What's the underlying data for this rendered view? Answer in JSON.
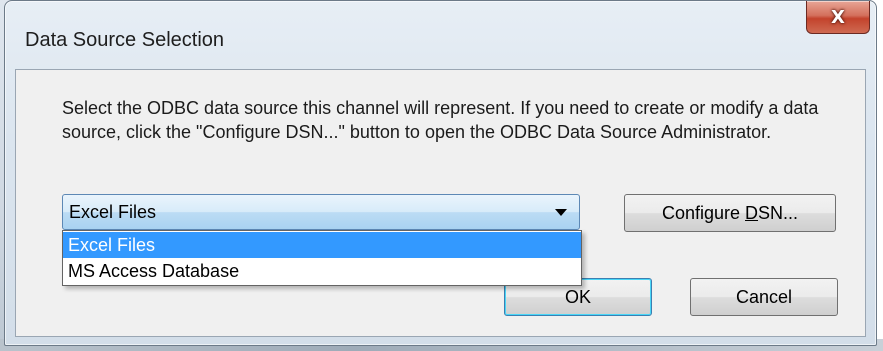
{
  "window": {
    "title": "Data Source Selection",
    "close_glyph": "X"
  },
  "description": "Select the ODBC data source this channel will represent. If you need to create or modify a data source, click the \"Configure DSN...\" button to open the ODBC Data Source Administrator.",
  "combo": {
    "selected": "Excel Files",
    "options": [
      "Excel Files",
      "MS Access Database"
    ]
  },
  "buttons": {
    "configure_prefix": "Configure ",
    "configure_mnemonic": "D",
    "configure_suffix": "SN...",
    "ok": "OK",
    "cancel": "Cancel"
  },
  "colors": {
    "selection": "#3399ff",
    "close_button": "#c3432c"
  }
}
